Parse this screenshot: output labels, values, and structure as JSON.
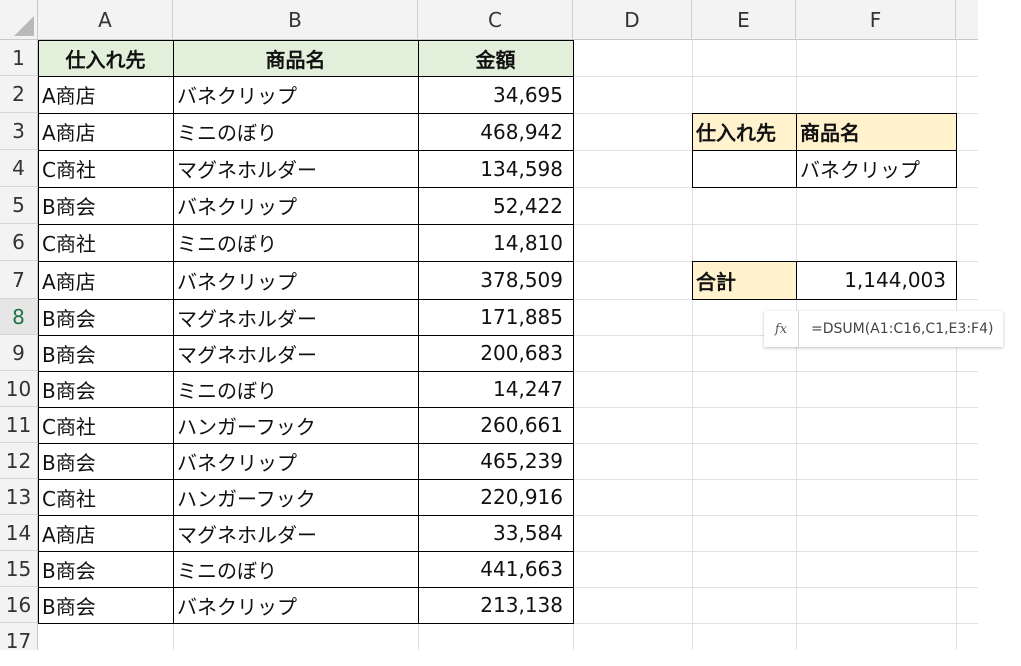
{
  "columns": [
    "A",
    "B",
    "C",
    "D",
    "E",
    "F"
  ],
  "rows": [
    "1",
    "2",
    "3",
    "4",
    "5",
    "6",
    "7",
    "8",
    "9",
    "10",
    "11",
    "12",
    "13",
    "14",
    "15",
    "16",
    "17"
  ],
  "main_table": {
    "headers": [
      "仕入れ先",
      "商品名",
      "金額"
    ],
    "rows": [
      [
        "A商店",
        "バネクリップ",
        "34,695"
      ],
      [
        "A商店",
        "ミニのぼり",
        "468,942"
      ],
      [
        "C商社",
        "マグネホルダー",
        "134,598"
      ],
      [
        "B商会",
        "バネクリップ",
        "52,422"
      ],
      [
        "C商社",
        "ミニのぼり",
        "14,810"
      ],
      [
        "A商店",
        "バネクリップ",
        "378,509"
      ],
      [
        "B商会",
        "マグネホルダー",
        "171,885"
      ],
      [
        "B商会",
        "マグネホルダー",
        "200,683"
      ],
      [
        "B商会",
        "ミニのぼり",
        "14,247"
      ],
      [
        "C商社",
        "ハンガーフック",
        "260,661"
      ],
      [
        "B商会",
        "バネクリップ",
        "465,239"
      ],
      [
        "C商社",
        "ハンガーフック",
        "220,916"
      ],
      [
        "A商店",
        "マグネホルダー",
        "33,584"
      ],
      [
        "B商会",
        "ミニのぼり",
        "441,663"
      ],
      [
        "B商会",
        "バネクリップ",
        "213,138"
      ]
    ]
  },
  "criteria": {
    "header_supplier": "仕入れ先",
    "header_product": "商品名",
    "supplier_value": "",
    "product_value": "バネクリップ"
  },
  "total": {
    "label": "合計",
    "value": "1,144,003"
  },
  "formula_tip": {
    "icon": "fx-icon",
    "fx_label": "fx",
    "formula": "=DSUM(A1:C16,C1,E3:F4)"
  },
  "selected_row": "8",
  "colors": {
    "header_green": "#e2efda",
    "header_yellow": "#fff2cc",
    "excel_green": "#217346"
  }
}
